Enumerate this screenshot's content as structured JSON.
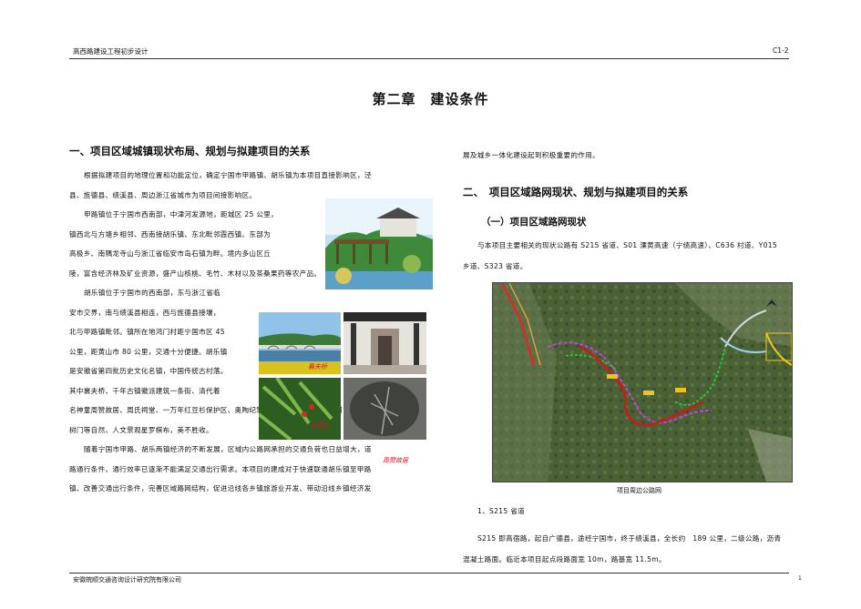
{
  "header": {
    "left": "高西路建设工程初步设计",
    "right": "C1-2"
  },
  "title": "第二章　建设条件",
  "left": {
    "heading": "一、项目区域城镇现状布局、规划与拟建项目的关系",
    "paras": [
      "根据拟建项目的地理位置和功能定位，确定宁国市甲路镇、胡乐镇为本项目直接影响区，泾",
      "县、旌德县、绩溪县、周边浙江省城市为项目间接影响区。",
      "甲路镇位于宁国市西南部，中津河发源地，距城区 25 公里，",
      "镇西北与方塘乡相邻、西南接胡乐镇、东北毗邻霞西镇、东部为",
      "高极乡、南隅龙寺山与浙江省临安市岛石镇为畔。境内多山区丘",
      "陵，富含经济林及矿业资源，盛产山核桃、毛竹、木材以及茶桑果药等农产品。",
      "胡乐镇位于宁国市的西南部，东与浙江省临",
      "安市交界，南与绩溪县相连，西与旌德县接壤，",
      "北与甲路镇毗邻。镇所在地鸿门村距宁国市区 45",
      "公里，距黄山市 80 公里，交通十分便捷。胡乐镇",
      "是安徽省第四批历史文化名镇，中国传统古村落。",
      "其中襄夫桥、千年古镇徽派建筑一条街、清代着",
      "名神童周赞故居、周氏祠堂、一万年红豆杉保护区、奥陶纪笔石化石地质遗迹、龙池阳日山的塔",
      "树门等自然、人文景观星罗棋布，美不胜收。",
      "随着宁国市甲路、胡乐两镇经济的不断发展，区域内公路网承担的交通负荷也日益增大，道",
      "路通行条件、通行效率已逐渐不能满足交通出行需求。本项目的建成对于快速联通胡乐镇至甲路",
      "镇、改善交通出行条件，完善区域路网结构，促进沿线各乡镇旅游业开发、带动沿线乡镇经济发"
    ],
    "photo_labels": {
      "bridge": "襄夫桥",
      "yew": "红豆杉",
      "residence": "周赞故居"
    }
  },
  "right": {
    "cont": "展及城乡一体化建设起到积极重要的作用。",
    "heading2": "二、　项目区域路网现状、规划与拟建项目的关系",
    "heading3": "（一）项目区域路网现状",
    "p1": "与本项目主要相关的现状公路有 S215 省道、S01 溧黄高速（宁绩高速）、C636 村道、Y015",
    "p2": "乡道、S323 省道。",
    "map_caption": "项目周边公路网",
    "sub": "1、S215 省道",
    "p3": "S215 即高宿路，起自广德县，途经宁国市，终于绩溪县，全长约　189 公里，二级公路，沥青",
    "p4": "混凝土路面。临近本项目起点段路面宽 10m，路基宽 11.5m。"
  },
  "footer": {
    "left": "安徽皖顺交通咨询设计研究院有限公司",
    "page": "1"
  },
  "colors": {
    "proposed_route": "#d01818",
    "existing_green": "#29c43a",
    "magenta_route": "#c046d8",
    "yellow_road": "#f4c21c"
  }
}
